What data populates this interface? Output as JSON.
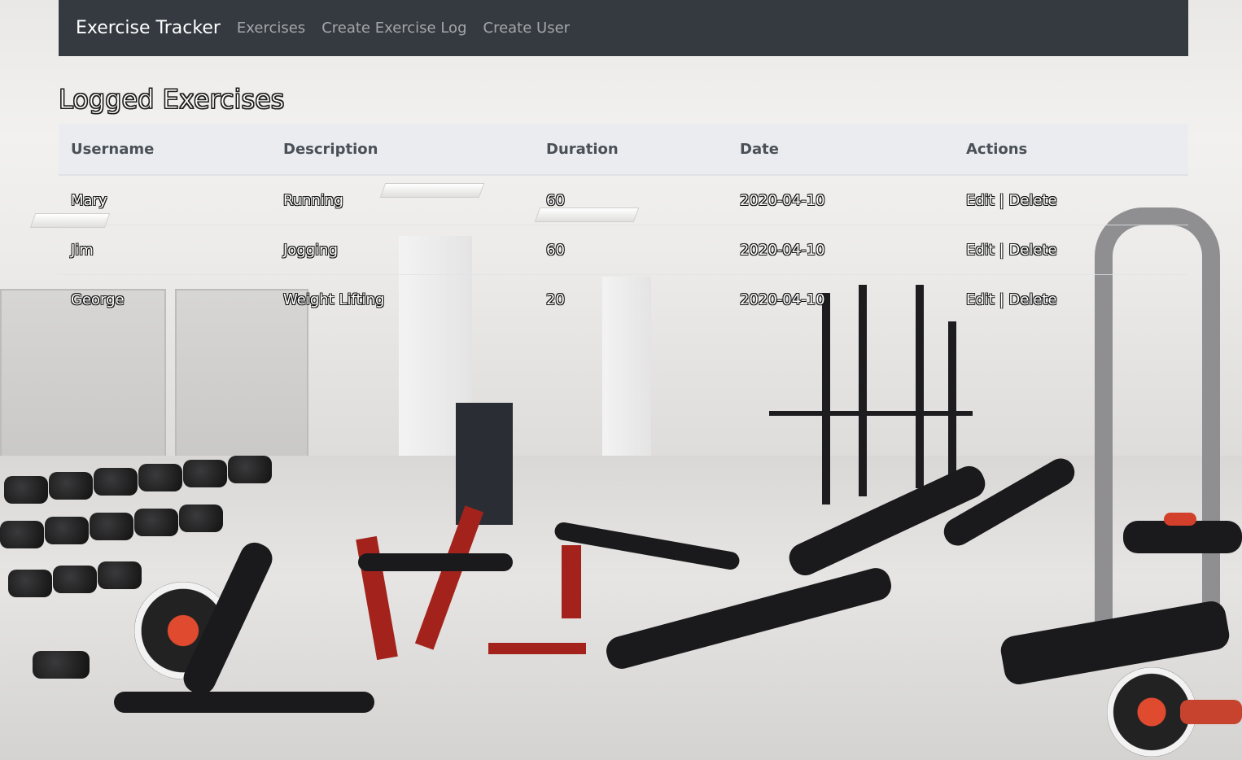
{
  "navbar": {
    "brand": "Exercise Tracker",
    "links": [
      "Exercises",
      "Create Exercise Log",
      "Create User"
    ]
  },
  "page": {
    "title": "Logged Exercises"
  },
  "table": {
    "headers": [
      "Username",
      "Description",
      "Duration",
      "Date",
      "Actions"
    ],
    "rows": [
      {
        "username": "Mary",
        "description": "Running",
        "duration": "60",
        "date": "2020-04-10"
      },
      {
        "username": "Jim",
        "description": "Jogging",
        "duration": "60",
        "date": "2020-04-10"
      },
      {
        "username": "George",
        "description": "Weight Lifting",
        "duration": "20",
        "date": "2020-04-10"
      }
    ],
    "actions": {
      "edit": "Edit",
      "separator": "|",
      "delete": "Delete"
    }
  },
  "colors": {
    "navbar_bg": "#343a40",
    "header_bg": "#e9ecef"
  }
}
